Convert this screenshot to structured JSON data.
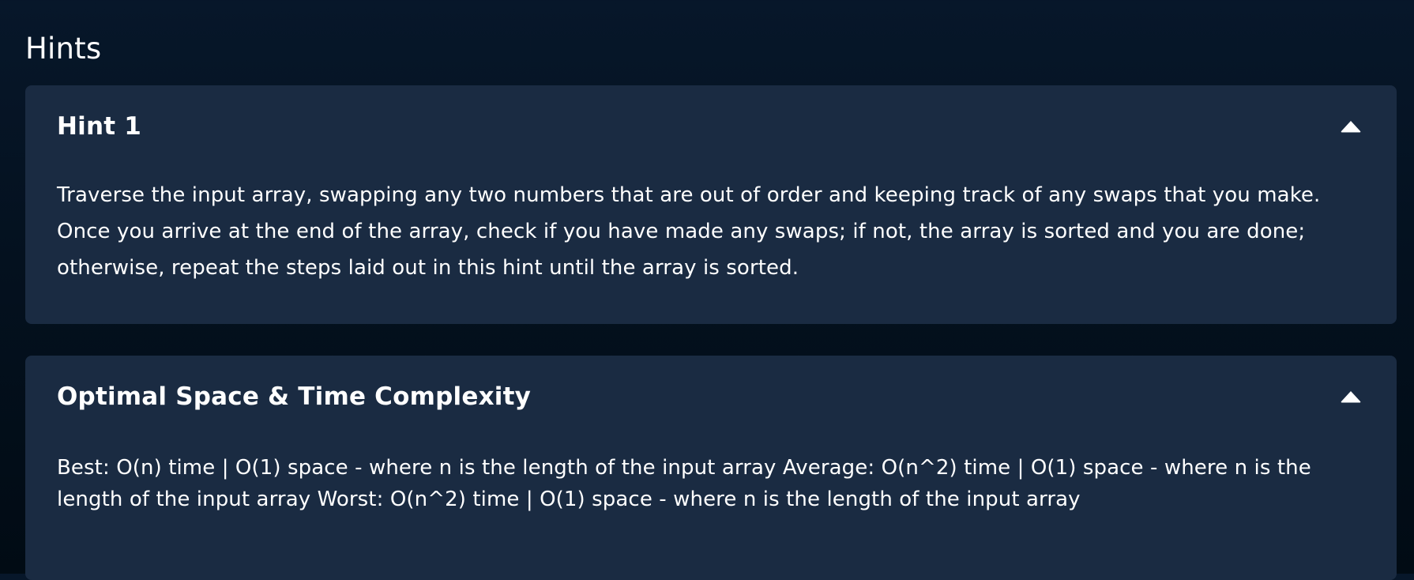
{
  "section": {
    "title": "Hints"
  },
  "panels": [
    {
      "title": "Hint 1",
      "expanded": true,
      "toggle_icon": "caret-up-icon",
      "body": "Traverse the input array, swapping any two numbers that are out of order and keeping track of any swaps that you make. Once you arrive at the end of the array, check if you have made any swaps; if not, the array is sorted and you are done; otherwise, repeat the steps laid out in this hint until the array is sorted."
    },
    {
      "title": "Optimal Space & Time Complexity",
      "expanded": true,
      "toggle_icon": "caret-up-icon",
      "body": "Best: O(n) time | O(1) space - where n is the length of the input array Average: O(n^2) time | O(1) space - where n is the length of the input array Worst: O(n^2) time | O(1) space - where n is the length of the input array"
    }
  ],
  "colors": {
    "background": "#04111f",
    "panel": "#1a2b42",
    "text": "#ffffff"
  }
}
